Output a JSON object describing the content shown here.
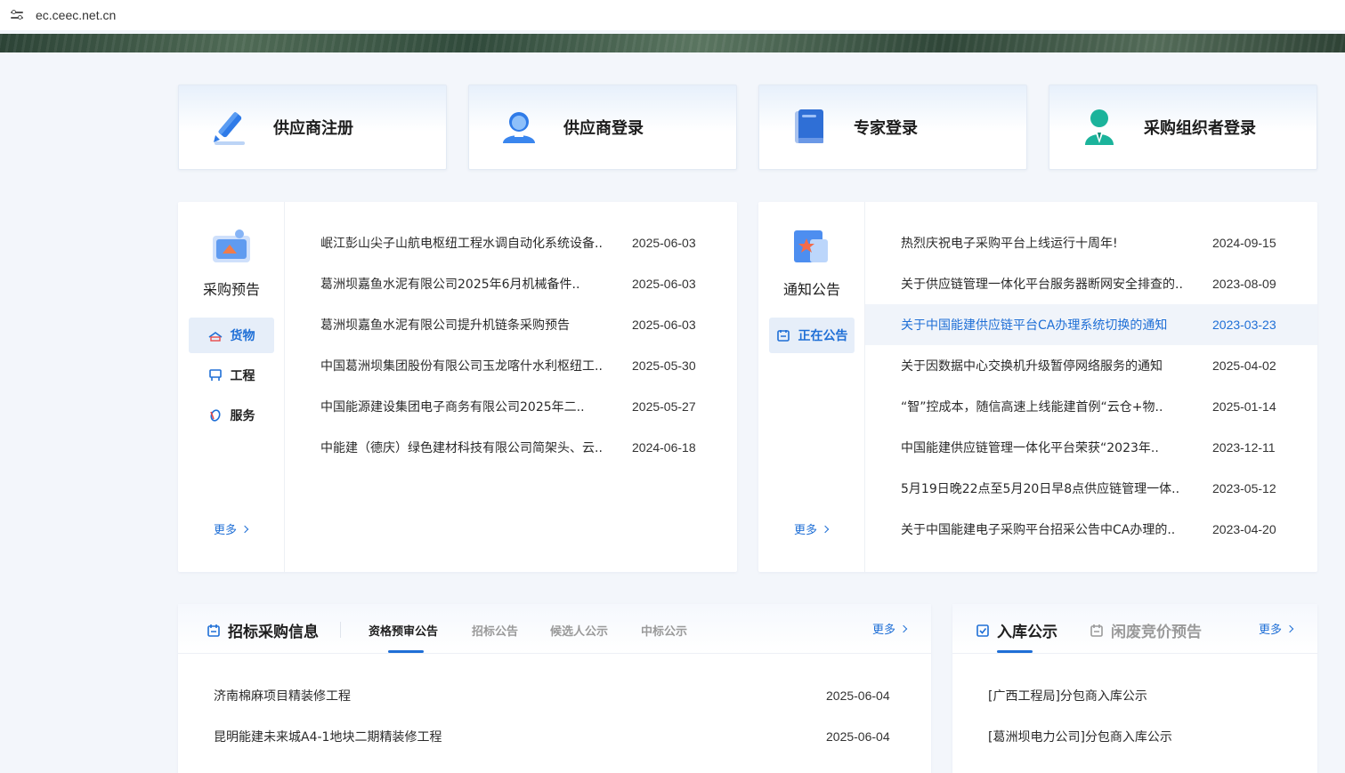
{
  "browser": {
    "url": "ec.ceec.net.cn"
  },
  "login_cards": [
    {
      "label": "供应商注册",
      "icon": "pen-icon"
    },
    {
      "label": "供应商登录",
      "icon": "user-login-icon"
    },
    {
      "label": "专家登录",
      "icon": "book-icon"
    },
    {
      "label": "采购组织者登录",
      "icon": "person-icon"
    }
  ],
  "procurement_forecast": {
    "title": "采购预告",
    "categories": [
      {
        "label": "货物",
        "icon": "goods-icon",
        "active": true
      },
      {
        "label": "工程",
        "icon": "engineering-icon",
        "active": false
      },
      {
        "label": "服务",
        "icon": "service-icon",
        "active": false
      }
    ],
    "more": "更多",
    "items": [
      {
        "title": "岷江彭山尖子山航电枢纽工程水调自动化系统设备..",
        "date": "2025-06-03"
      },
      {
        "title": "葛洲坝嘉鱼水泥有限公司2025年6月机械备件..",
        "date": "2025-06-03"
      },
      {
        "title": "葛洲坝嘉鱼水泥有限公司提升机链条采购预告",
        "date": "2025-06-03"
      },
      {
        "title": "中国葛洲坝集团股份有限公司玉龙喀什水利枢纽工..",
        "date": "2025-05-30"
      },
      {
        "title": "中国能源建设集团电子商务有限公司2025年二..",
        "date": "2025-05-27"
      },
      {
        "title": "中能建（德庆）绿色建材科技有限公司简架头、云..",
        "date": "2024-06-18"
      }
    ]
  },
  "notices": {
    "title": "通知公告",
    "active_tab": "正在公告",
    "more": "更多",
    "items": [
      {
        "title": "热烈庆祝电子采购平台上线运行十周年!",
        "date": "2024-09-15"
      },
      {
        "title": "关于供应链管理一体化平台服务器断网安全排查的..",
        "date": "2023-08-09"
      },
      {
        "title": "关于中国能建供应链平台CA办理系统切换的通知",
        "date": "2023-03-23",
        "highlight": true
      },
      {
        "title": "关于因数据中心交换机升级暂停网络服务的通知",
        "date": "2025-04-02"
      },
      {
        "title": "“智”控成本，随信高速上线能建首例“云仓+物..",
        "date": "2025-01-14"
      },
      {
        "title": "中国能建供应链管理一体化平台荣获“2023年..",
        "date": "2023-12-11"
      },
      {
        "title": "5月19日晚22点至5月20日早8点供应链管理一体..",
        "date": "2023-05-12"
      },
      {
        "title": "关于中国能建电子采购平台招采公告中CA办理的..",
        "date": "2023-04-20"
      }
    ]
  },
  "tender_info": {
    "title": "招标采购信息",
    "tabs": [
      "资格预审公告",
      "招标公告",
      "候选人公示",
      "中标公示"
    ],
    "active_tab": 0,
    "more": "更多",
    "items": [
      {
        "title": "济南棉麻项目精装修工程",
        "date": "2025-06-04"
      },
      {
        "title": "昆明能建未来城A4-1地块二期精装修工程",
        "date": "2025-06-04"
      }
    ]
  },
  "warehouse": {
    "tabs": [
      "入库公示",
      "闲废竞价预告"
    ],
    "active_tab": 0,
    "more": "更多",
    "items": [
      {
        "title": "[广西工程局]分包商入库公示"
      },
      {
        "title": "[葛洲坝电力公司]分包商入库公示"
      }
    ]
  },
  "colors": {
    "accent": "#1f6fd6",
    "page_bg": "#f3f6fb"
  }
}
